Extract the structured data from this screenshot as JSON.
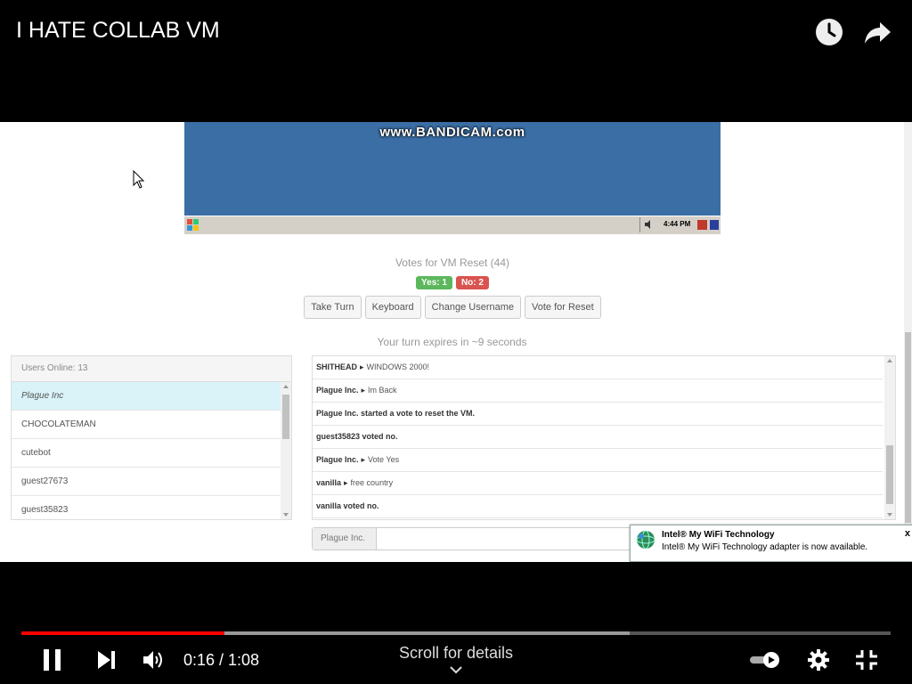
{
  "player": {
    "title": "I HATE COLLAB VM",
    "time_current": "0:16",
    "time_separator": "/",
    "time_total": "1:08",
    "time_display": "0:16 / 1:08",
    "progress_fraction": 0.2336,
    "buffered_fraction": 0.7,
    "scroll_hint": "Scroll for details",
    "colors": {
      "progress": "#ff0000",
      "background": "#000000"
    },
    "icons": [
      "clock-icon",
      "share-icon",
      "pause-icon",
      "next-icon",
      "volume-icon",
      "autoplay-toggle-icon",
      "gear-icon",
      "exit-fullscreen-icon"
    ]
  },
  "vm": {
    "watermark": "www.BANDICAM.com",
    "taskbar_clock": "4:44 PM",
    "desktop_color": "#3a6ea5"
  },
  "collabvm": {
    "votes_title": "Votes for VM Reset (44)",
    "vote_yes": "Yes: 1",
    "vote_no": "No: 2",
    "buttons": {
      "take_turn": "Take Turn",
      "keyboard": "Keyboard",
      "change_username": "Change Username",
      "vote_reset": "Vote for Reset"
    },
    "turn_text": "Your turn expires in ~9 seconds",
    "users_header": "Users Online: 13",
    "users": [
      "Plague Inc",
      "CHOCOLATEMAN",
      "cutebot",
      "guest27673",
      "guest35823"
    ],
    "chat": [
      {
        "user": "SHITHEAD",
        "sep": "▸",
        "text": "WINDOWS 2000!"
      },
      {
        "user": "Plague Inc.",
        "sep": "▸",
        "text": "Im Back"
      },
      {
        "system": "Plague Inc. started a vote to reset the VM."
      },
      {
        "system": "guest35823 voted no."
      },
      {
        "user": "Plague Inc.",
        "sep": "▸",
        "text": "Vote Yes"
      },
      {
        "user": "vanilla",
        "sep": "▸",
        "text": "free country"
      },
      {
        "system": "vanilla voted no."
      }
    ],
    "chat_input_label": "Plague Inc."
  },
  "notification": {
    "title": "Intel® My WiFi Technology",
    "body": "Intel® My WiFi Technology adapter is now available.",
    "close": "x"
  }
}
